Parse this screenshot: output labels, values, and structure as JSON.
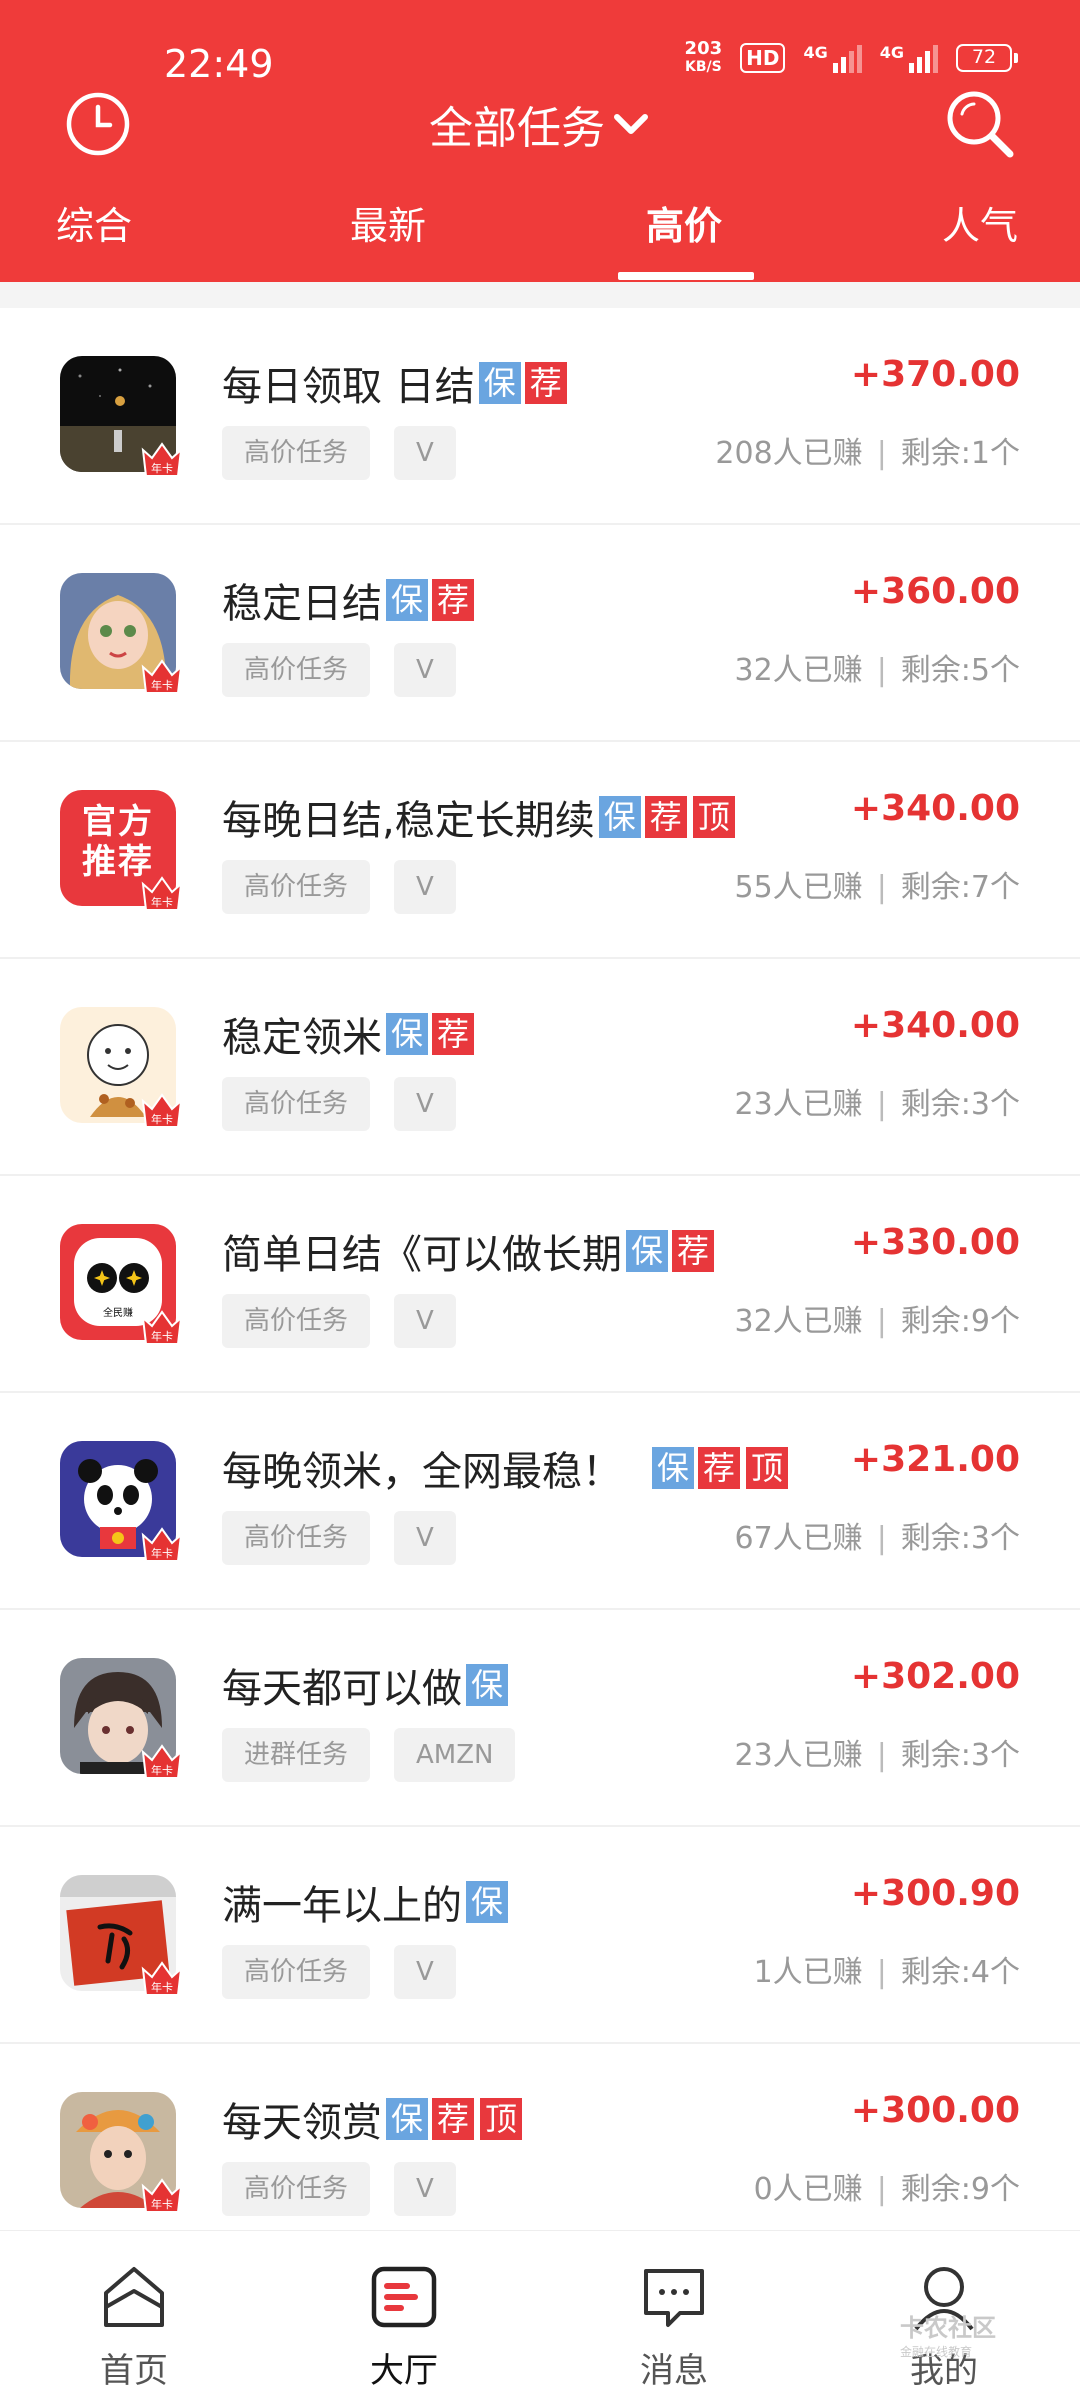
{
  "status": {
    "time": "22:49",
    "net_speed_value": "203",
    "net_speed_unit": "KB/S",
    "hd_label": "HD",
    "signal1_label": "4G",
    "signal2_label": "4G",
    "battery": "72"
  },
  "header": {
    "title": "全部任务",
    "left_icon": "clock-icon",
    "right_icon": "search-icon",
    "accent_color": "#ef3b3a"
  },
  "tabs": [
    {
      "label": "综合",
      "active": false
    },
    {
      "label": "最新",
      "active": false
    },
    {
      "label": "高价",
      "active": true
    },
    {
      "label": "人气",
      "active": false
    }
  ],
  "tag_labels": {
    "bao": "保",
    "jian": "荐",
    "ding": "顶"
  },
  "items": [
    {
      "title": "每日领取 日结",
      "tags": [
        "bao",
        "jian"
      ],
      "chips": [
        "高价任务",
        "V"
      ],
      "price": "+370.00",
      "earned": "208人已赚",
      "remaining": "剩余:1个"
    },
    {
      "title": "稳定日结",
      "tags": [
        "bao",
        "jian"
      ],
      "chips": [
        "高价任务",
        "V"
      ],
      "price": "+360.00",
      "earned": "32人已赚",
      "remaining": "剩余:5个"
    },
    {
      "title": "每晚日结,稳定长期续",
      "tags": [
        "bao",
        "jian",
        "ding"
      ],
      "chips": [
        "高价任务",
        "V"
      ],
      "price": "+340.00",
      "earned": "55人已赚",
      "remaining": "剩余:7个"
    },
    {
      "title": "稳定领米",
      "tags": [
        "bao",
        "jian"
      ],
      "chips": [
        "高价任务",
        "V"
      ],
      "price": "+340.00",
      "earned": "23人已赚",
      "remaining": "剩余:3个"
    },
    {
      "title": "简单日结《可以做长期",
      "tags": [
        "bao",
        "jian"
      ],
      "chips": [
        "高价任务",
        "V"
      ],
      "price": "+330.00",
      "earned": "32人已赚",
      "remaining": "剩余:9个"
    },
    {
      "title": "每晚领米，全网最稳！",
      "tags": [
        "bao",
        "jian",
        "ding"
      ],
      "chips": [
        "高价任务",
        "V"
      ],
      "price": "+321.00",
      "earned": "67人已赚",
      "remaining": "剩余:3个"
    },
    {
      "title": "每天都可以做",
      "tags": [
        "bao"
      ],
      "chips": [
        "进群任务",
        "AMZN"
      ],
      "price": "+302.00",
      "earned": "23人已赚",
      "remaining": "剩余:3个"
    },
    {
      "title": "满一年以上的",
      "tags": [
        "bao"
      ],
      "chips": [
        "高价任务",
        "V"
      ],
      "price": "+300.90",
      "earned": "1人已赚",
      "remaining": "剩余:4个"
    },
    {
      "title": "每天领赏",
      "tags": [
        "bao",
        "jian",
        "ding"
      ],
      "chips": [
        "高价任务",
        "V"
      ],
      "price": "+300.00",
      "earned": "0人已赚",
      "remaining": "剩余:9个"
    }
  ],
  "avatar_text": {
    "official": "官方推荐",
    "crown": "年卡",
    "app": "全民赚"
  },
  "nav": [
    {
      "label": "首页",
      "icon": "home-icon",
      "active": false
    },
    {
      "label": "大厅",
      "icon": "hall-icon",
      "active": true
    },
    {
      "label": "消息",
      "icon": "message-icon",
      "active": false
    },
    {
      "label": "我的",
      "icon": "profile-icon",
      "active": false
    }
  ],
  "watermark": {
    "main": "卡农社区",
    "sub": "金融在线教育"
  }
}
